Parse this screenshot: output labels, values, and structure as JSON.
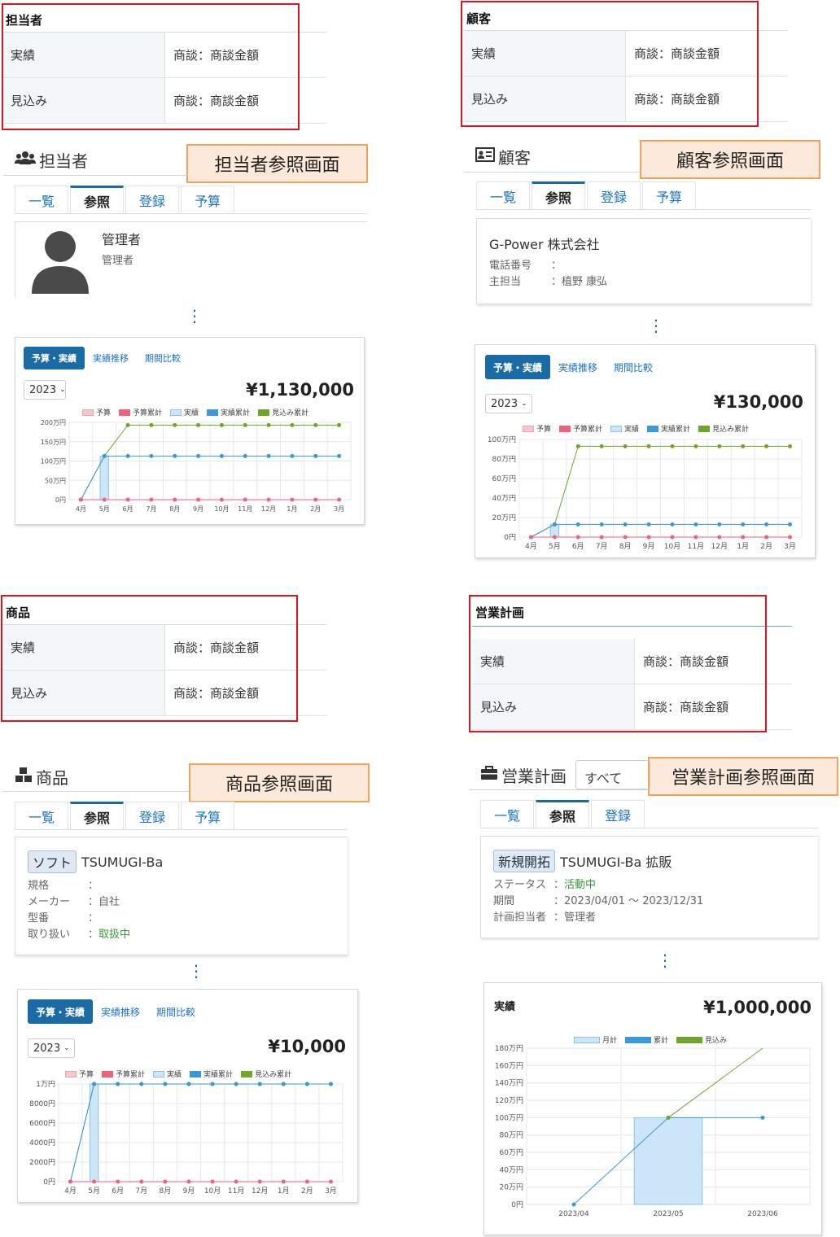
{
  "summaries": {
    "tanto": {
      "title": "担当者",
      "rows": [
        {
          "label": "実績",
          "value": "商談：商談金額"
        },
        {
          "label": "見込み",
          "value": "商談：商談金額"
        }
      ]
    },
    "kokyaku": {
      "title": "顧客",
      "rows": [
        {
          "label": "実績",
          "value": "商談：商談金額"
        },
        {
          "label": "見込み",
          "value": "商談：商談金額"
        }
      ]
    },
    "shohin": {
      "title": "商品",
      "rows": [
        {
          "label": "実績",
          "value": "商談：商談金額"
        },
        {
          "label": "見込み",
          "value": "商談：商談金額"
        }
      ]
    },
    "keikaku": {
      "title": "営業計画",
      "rows": [
        {
          "label": "実績",
          "value": "商談：商談金額"
        },
        {
          "label": "見込み",
          "value": "商談：商談金額"
        }
      ]
    }
  },
  "callouts": {
    "tanto": "担当者参照画面",
    "kokyaku": "顧客参照画面",
    "shohin": "商品参照画面",
    "keikaku": "営業計画参照画面"
  },
  "tanto": {
    "heading": "担当者",
    "tabs": [
      "一覧",
      "参照",
      "登録",
      "予算"
    ],
    "profile": {
      "name": "管理者",
      "role": "管理者"
    }
  },
  "kokyaku": {
    "heading": "顧客",
    "tabs": [
      "一覧",
      "参照",
      "登録",
      "予算"
    ],
    "company": "G-Power 株式会社",
    "fields": [
      {
        "k": "電話番号",
        "v": "："
      },
      {
        "k": "主担当",
        "v": "：植野 康弘"
      }
    ]
  },
  "shohin": {
    "heading": "商品",
    "tabs": [
      "一覧",
      "参照",
      "登録",
      "予算"
    ],
    "badge": "ソフト",
    "name": "TSUMUGI-Ba",
    "fields": [
      {
        "k": "規格",
        "v": "："
      },
      {
        "k": "メーカー",
        "v": "：自社"
      },
      {
        "k": "型番",
        "v": "："
      },
      {
        "k": "取り扱い",
        "v": "：",
        "green": "取扱中"
      }
    ]
  },
  "keikaku": {
    "heading": "営業計画",
    "select": "すべて",
    "tabs": [
      "一覧",
      "参照",
      "登録"
    ],
    "badge": "新規開拓",
    "name": "TSUMUGI-Ba 拡販",
    "fields": [
      {
        "k": "ステータス",
        "v": "：",
        "green": "活動中"
      },
      {
        "k": "期間",
        "v": "：2023/04/01 ～ 2023/12/31"
      },
      {
        "k": "計画担当者",
        "v": "：管理者"
      }
    ]
  },
  "chart_tabs": [
    "予算・実績",
    "実績推移",
    "期間比較"
  ],
  "year": "2023",
  "legend": [
    "予算",
    "予算累計",
    "実績",
    "実績累計",
    "見込み累計"
  ],
  "legend_keikaku": [
    "月計",
    "累計",
    "見込み"
  ],
  "colors": {
    "budget": "#f7c5cf",
    "budget_cum": "#f0617c",
    "actual": "#cde6f7",
    "actual_cum": "#3a9ad9",
    "forecast_cum": "#6fa52a",
    "accent": "#1a6aa6",
    "red": "#e0141e"
  },
  "chart_data": [
    {
      "type": "line",
      "id": "tanto",
      "amount": "¥1,130,000",
      "categories": [
        "4月",
        "5月",
        "6月",
        "7月",
        "8月",
        "9月",
        "10月",
        "11月",
        "12月",
        "1月",
        "2月",
        "3月"
      ],
      "yticks": [
        "200万円",
        "150万円",
        "100万円",
        "50万円",
        "0円"
      ],
      "ylim": [
        0,
        200
      ],
      "series": [
        {
          "name": "予算累計",
          "values": [
            0,
            0,
            0,
            0,
            0,
            0,
            0,
            0,
            0,
            0,
            0,
            0
          ]
        },
        {
          "name": "実績",
          "type": "bar",
          "values": [
            0,
            113,
            0,
            0,
            0,
            0,
            0,
            0,
            0,
            0,
            0,
            0
          ]
        },
        {
          "name": "実績累計",
          "values": [
            0,
            113,
            113,
            113,
            113,
            113,
            113,
            113,
            113,
            113,
            113,
            113
          ]
        },
        {
          "name": "見込み累計",
          "values": [
            0,
            113,
            193,
            193,
            193,
            193,
            193,
            193,
            193,
            193,
            193,
            193
          ]
        }
      ]
    },
    {
      "type": "line",
      "id": "kokyaku",
      "amount": "¥130,000",
      "categories": [
        "4月",
        "5月",
        "6月",
        "7月",
        "8月",
        "9月",
        "10月",
        "11月",
        "12月",
        "1月",
        "2月",
        "3月"
      ],
      "yticks": [
        "100万円",
        "80万円",
        "60万円",
        "40万円",
        "20万円",
        "0円"
      ],
      "ylim": [
        0,
        100
      ],
      "series": [
        {
          "name": "予算累計",
          "values": [
            0,
            0,
            0,
            0,
            0,
            0,
            0,
            0,
            0,
            0,
            0,
            0
          ]
        },
        {
          "name": "実績",
          "type": "bar",
          "values": [
            0,
            13,
            0,
            0,
            0,
            0,
            0,
            0,
            0,
            0,
            0,
            0
          ]
        },
        {
          "name": "実績累計",
          "values": [
            0,
            13,
            13,
            13,
            13,
            13,
            13,
            13,
            13,
            13,
            13,
            13
          ]
        },
        {
          "name": "見込み累計",
          "values": [
            0,
            13,
            93,
            93,
            93,
            93,
            93,
            93,
            93,
            93,
            93,
            93
          ]
        }
      ]
    },
    {
      "type": "line",
      "id": "shohin",
      "amount": "¥10,000",
      "categories": [
        "4月",
        "5月",
        "6月",
        "7月",
        "8月",
        "9月",
        "10月",
        "11月",
        "12月",
        "1月",
        "2月",
        "3月"
      ],
      "yticks": [
        "1万円",
        "8000円",
        "6000円",
        "4000円",
        "2000円",
        "0円"
      ],
      "ylim": [
        0,
        10000
      ],
      "series": [
        {
          "name": "予算累計",
          "values": [
            0,
            0,
            0,
            0,
            0,
            0,
            0,
            0,
            0,
            0,
            0,
            0
          ]
        },
        {
          "name": "実績",
          "type": "bar",
          "values": [
            0,
            10000,
            0,
            0,
            0,
            0,
            0,
            0,
            0,
            0,
            0,
            0
          ]
        },
        {
          "name": "実績累計",
          "values": [
            0,
            10000,
            10000,
            10000,
            10000,
            10000,
            10000,
            10000,
            10000,
            10000,
            10000,
            10000
          ]
        },
        {
          "name": "見込み累計",
          "values": [
            0,
            10000,
            10000,
            10000,
            10000,
            10000,
            10000,
            10000,
            10000,
            10000,
            10000,
            10000
          ]
        }
      ]
    },
    {
      "type": "line",
      "id": "keikaku",
      "title": "実績",
      "amount": "¥1,000,000",
      "categories": [
        "2023/04",
        "2023/05",
        "2023/06"
      ],
      "yticks": [
        "180万円",
        "160万円",
        "140万円",
        "120万円",
        "100万円",
        "80万円",
        "60万円",
        "40万円",
        "20万円",
        "0円"
      ],
      "ylim": [
        0,
        180
      ],
      "series": [
        {
          "name": "月計",
          "type": "bar",
          "values": [
            0,
            100,
            0
          ]
        },
        {
          "name": "累計",
          "values": [
            0,
            100,
            100
          ]
        },
        {
          "name": "見込み",
          "values": [
            null,
            100,
            180
          ]
        }
      ]
    }
  ]
}
